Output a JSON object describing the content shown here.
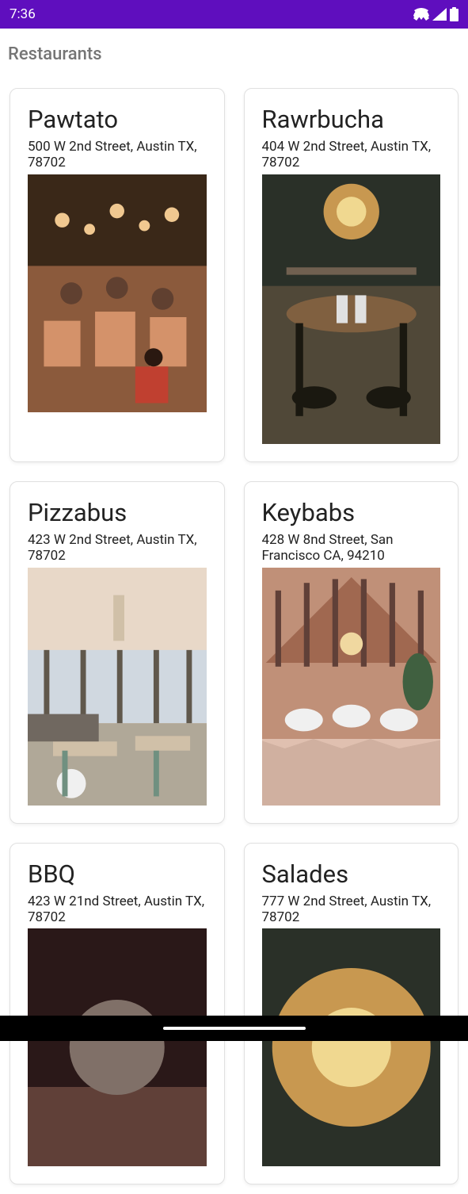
{
  "statusBar": {
    "time": "7:36"
  },
  "pageTitle": "Restaurants",
  "restaurants": [
    {
      "name": "Pawtato",
      "address": "500 W 2nd Street, Austin TX, 78702",
      "imageColors": [
        "#8b5a3c",
        "#d4926a",
        "#3a2818",
        "#f0c890"
      ]
    },
    {
      "name": "Rawrbucha",
      "address": "404 W 2nd Street, Austin TX, 78702",
      "imageColors": [
        "#2a3028",
        "#c89850",
        "#504838",
        "#806040"
      ]
    },
    {
      "name": "Pizzabus",
      "address": "423 W 2nd Street, Austin TX, 78702",
      "imageColors": [
        "#e8d8c8",
        "#b0a898",
        "#60584c",
        "#d0c0a8"
      ]
    },
    {
      "name": "Keybabs",
      "address": "428 W 8nd Street, San Francisco CA, 94210",
      "imageColors": [
        "#a06850",
        "#e0c0b0",
        "#604038",
        "#c09078"
      ]
    },
    {
      "name": "BBQ",
      "address": "423 W 21nd Street, Austin TX, 78702",
      "imageColors": [
        "#2a1818",
        "#604038",
        "#807068",
        "#403028"
      ]
    },
    {
      "name": "Salades",
      "address": "777 W 2nd Street, Austin TX, 78702",
      "imageColors": [
        "#2a3028",
        "#c89850",
        "#504838",
        "#806040"
      ]
    }
  ]
}
